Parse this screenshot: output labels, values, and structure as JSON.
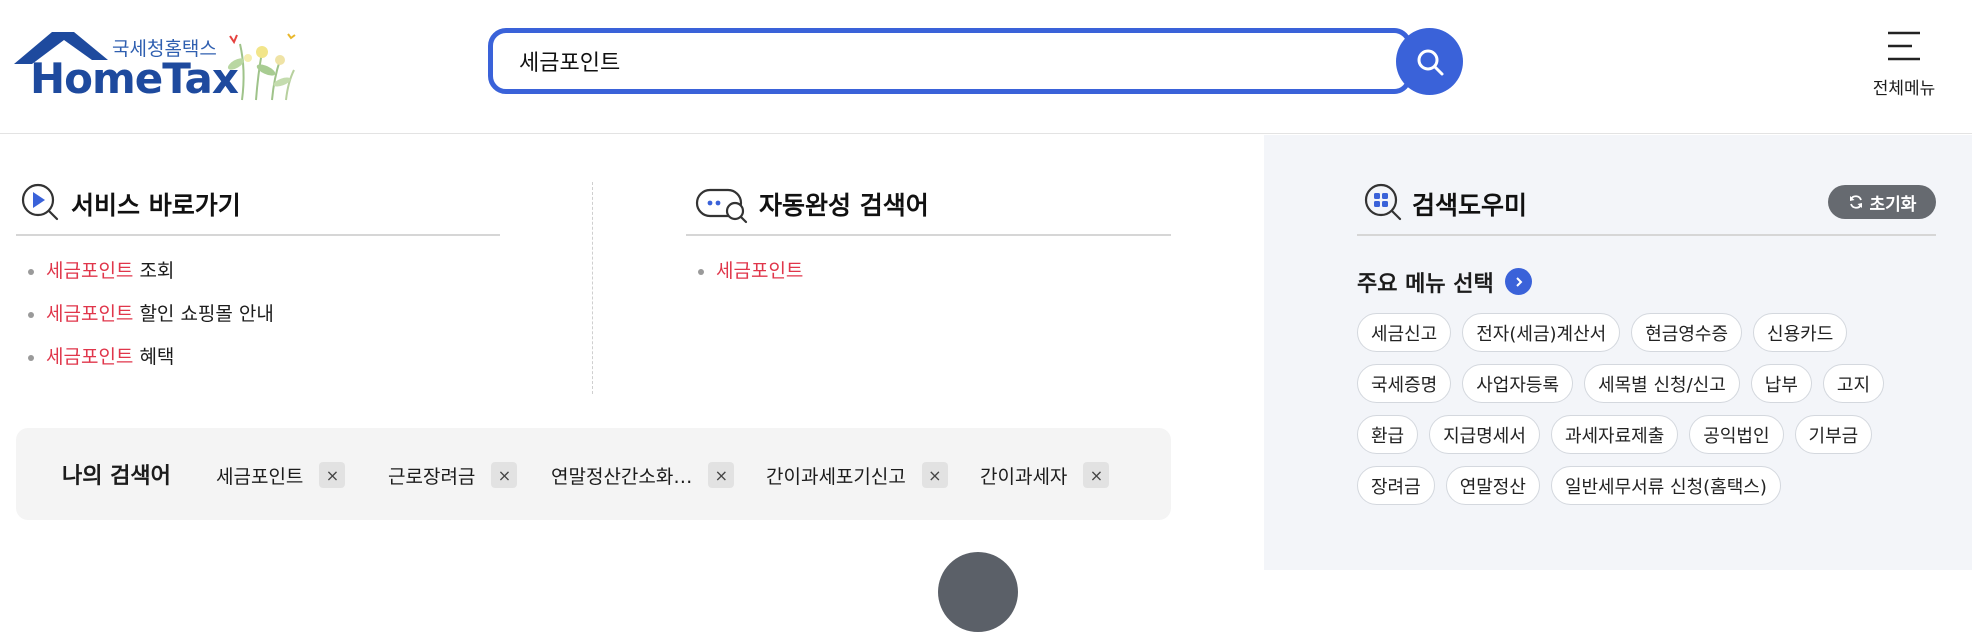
{
  "logo": {
    "korean": "국세청홈택스",
    "english": "HomeTax"
  },
  "search": {
    "value": "세금포인트",
    "placeholder": ""
  },
  "menu": {
    "label": "전체메뉴"
  },
  "services": {
    "title": "서비스 바로가기",
    "items": [
      {
        "highlight": "세금포인트",
        "rest": " 조회"
      },
      {
        "highlight": "세금포인트",
        "rest": " 할인 쇼핑몰 안내"
      },
      {
        "highlight": "세금포인트",
        "rest": " 혜택"
      }
    ]
  },
  "autocomplete": {
    "title": "자동완성 검색어",
    "items": [
      {
        "highlight": "세금포인트"
      }
    ]
  },
  "my_search": {
    "title": "나의 검색어",
    "terms": [
      "세금포인트",
      "근로장려금",
      "연말정산간소화…",
      "간이과세포기신고",
      "간이과세자"
    ],
    "close_glyph": "×"
  },
  "helper": {
    "title": "검색도우미",
    "reset_label": "초기화",
    "subtitle": "주요 메뉴 선택",
    "tag_rows": [
      [
        "세금신고",
        "전자(세금)계산서",
        "현금영수증",
        "신용카드"
      ],
      [
        "국세증명",
        "사업자등록",
        "세목별 신청/신고",
        "납부",
        "고지"
      ],
      [
        "환급",
        "지급명세서",
        "과세자료제출",
        "공익법인",
        "기부금"
      ],
      [
        "장려금",
        "연말정산",
        "일반세무서류 신청(홈택스)"
      ]
    ]
  },
  "colors": {
    "accent": "#3a62d9",
    "highlight": "#e0364b",
    "helper_bg": "#f3f5f9"
  }
}
